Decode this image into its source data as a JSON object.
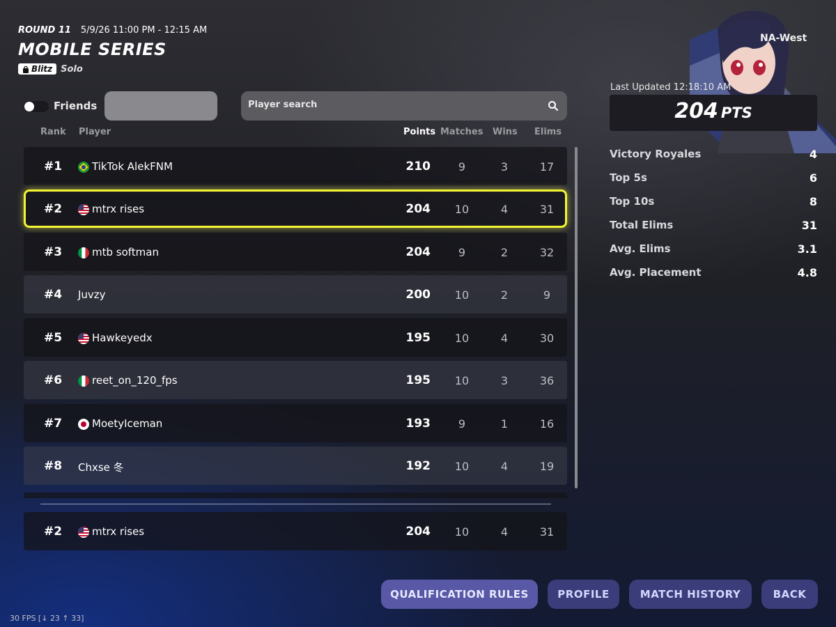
{
  "header": {
    "round": "ROUND 11",
    "when": "5/9/26 11:00 PM - 12:15 AM",
    "title": "MOBILE SERIES",
    "badge": "Blitz",
    "mode": "Solo"
  },
  "controls": {
    "friends_label": "Friends",
    "friends_toggle_on": false,
    "search_placeholder": "Player search"
  },
  "columns": {
    "rank": "Rank",
    "player": "Player",
    "points": "Points",
    "matches": "Matches",
    "wins": "Wins",
    "elims": "Elims"
  },
  "rows": [
    {
      "rank": "#1",
      "flag": "brazil",
      "name": "TikTok AlekFNM",
      "points": "210",
      "matches": "9",
      "wins": "3",
      "elims": "17"
    },
    {
      "rank": "#2",
      "flag": "usa",
      "name": "mtrx rises",
      "points": "204",
      "matches": "10",
      "wins": "4",
      "elims": "31"
    },
    {
      "rank": "#3",
      "flag": "italy",
      "name": "mtb softman",
      "points": "204",
      "matches": "9",
      "wins": "2",
      "elims": "32"
    },
    {
      "rank": "#4",
      "flag": "",
      "name": "Juvzy",
      "points": "200",
      "matches": "10",
      "wins": "2",
      "elims": "9"
    },
    {
      "rank": "#5",
      "flag": "usa",
      "name": "Hawkeyedx",
      "points": "195",
      "matches": "10",
      "wins": "4",
      "elims": "30"
    },
    {
      "rank": "#6",
      "flag": "italy",
      "name": "reet_on_120_fps",
      "points": "195",
      "matches": "10",
      "wins": "3",
      "elims": "36"
    },
    {
      "rank": "#7",
      "flag": "japan",
      "name": "MoetyIceman",
      "points": "193",
      "matches": "9",
      "wins": "1",
      "elims": "16"
    },
    {
      "rank": "#8",
      "flag": "",
      "name": "Chxse 冬",
      "points": "192",
      "matches": "10",
      "wins": "4",
      "elims": "19"
    }
  ],
  "my_row": {
    "rank": "#2",
    "flag": "usa",
    "name": "mtrx rises",
    "points": "204",
    "matches": "10",
    "wins": "4",
    "elims": "31"
  },
  "panel": {
    "region": "NA-West",
    "last_updated": "Last Updated 12:18:10 AM",
    "points_value": "204",
    "points_unit": "PTS",
    "stats": [
      {
        "label": "Victory Royales",
        "value": "4"
      },
      {
        "label": "Top 5s",
        "value": "6"
      },
      {
        "label": "Top 10s",
        "value": "8"
      },
      {
        "label": "Total Elims",
        "value": "31"
      },
      {
        "label": "Avg. Elims",
        "value": "3.1"
      },
      {
        "label": "Avg. Placement",
        "value": "4.8"
      }
    ]
  },
  "buttons": {
    "qualification_rules": "QUALIFICATION RULES",
    "profile": "PROFILE",
    "match_history": "MATCH HISTORY",
    "back": "BACK"
  },
  "debug": {
    "fps": "30 FPS [↓ 23 ↑ 33]"
  },
  "colors": {
    "highlight": "#f2f533",
    "button": "#3a3d7a",
    "button_primary": "#5858a6"
  }
}
